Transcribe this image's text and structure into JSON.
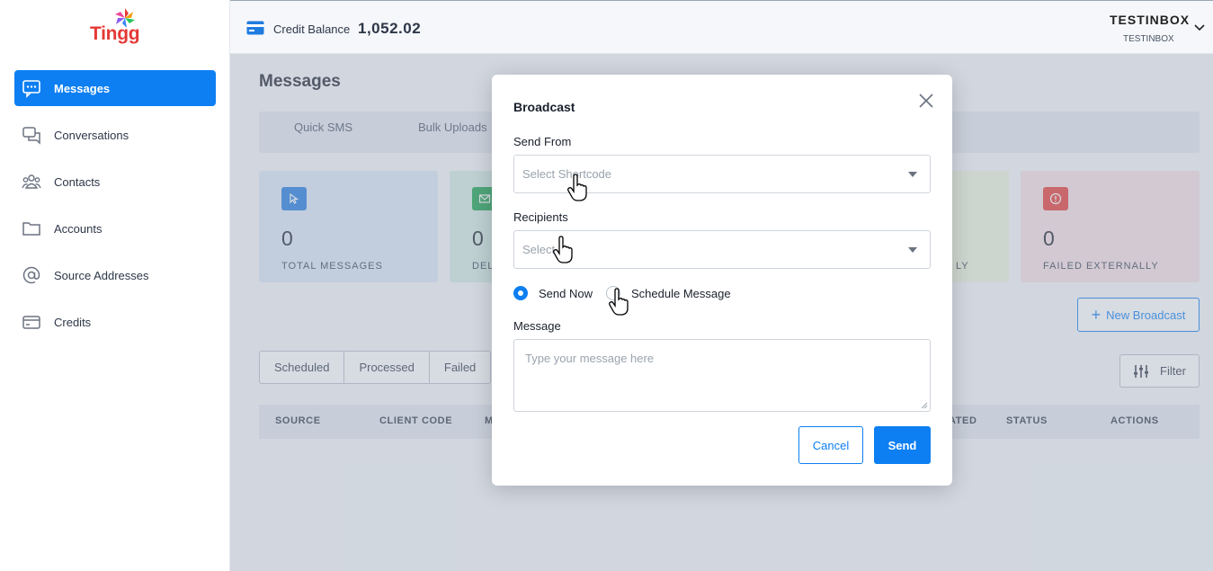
{
  "brand": {
    "name": "Tingg",
    "color": "#e53935"
  },
  "accent_color": "#0d7ff2",
  "sidebar": {
    "items": [
      {
        "label": "Messages",
        "icon": "chat-bubble-icon",
        "active": true
      },
      {
        "label": "Conversations",
        "icon": "conversations-icon",
        "active": false
      },
      {
        "label": "Contacts",
        "icon": "contacts-icon",
        "active": false
      },
      {
        "label": "Accounts",
        "icon": "folder-icon",
        "active": false
      },
      {
        "label": "Source Addresses",
        "icon": "at-sign-icon",
        "active": false
      },
      {
        "label": "Credits",
        "icon": "credit-card-icon",
        "active": false
      }
    ]
  },
  "topbar": {
    "credit_label": "Credit Balance",
    "credit_value": "1,052.02",
    "user_name": "TESTINBOX",
    "user_sub": "TESTINBOX"
  },
  "page": {
    "title": "Messages",
    "tabs": [
      "Quick SMS",
      "Bulk Uploads"
    ],
    "stats": [
      {
        "value": "0",
        "label": "TOTAL MESSAGES",
        "icon": "cursor-icon",
        "color": "#1f7be0"
      },
      {
        "value": "0",
        "label": "DEL",
        "icon": "envelope-icon",
        "color": "#16a34a"
      },
      {
        "value": "",
        "label": "LY",
        "icon": "",
        "color": "#84cc16"
      },
      {
        "value": "0",
        "label": "FAILED EXTERNALLY",
        "icon": "alert-icon",
        "color": "#e53935"
      }
    ],
    "new_broadcast_label": "New Broadcast",
    "filter_tabs": [
      "Scheduled",
      "Processed",
      "Failed"
    ],
    "filter_label": "Filter",
    "table_headers": [
      "SOURCE",
      "CLIENT CODE",
      "M",
      "ATED",
      "STATUS",
      "ACTIONS"
    ]
  },
  "modal": {
    "title": "Broadcast",
    "send_from_label": "Send From",
    "send_from_placeholder": "Select Shortcode",
    "recipients_label": "Recipients",
    "recipients_placeholder": "Select",
    "send_now_label": "Send Now",
    "schedule_label": "Schedule Message",
    "send_mode": "Send Now",
    "message_label": "Message",
    "message_placeholder": "Type your message here",
    "cancel_label": "Cancel",
    "send_label": "Send"
  }
}
